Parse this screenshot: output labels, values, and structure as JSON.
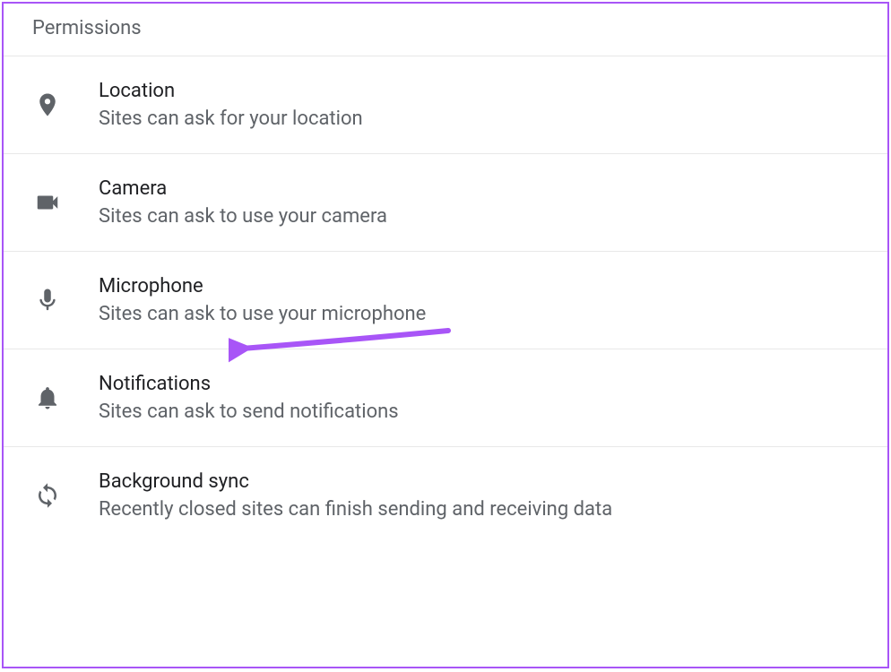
{
  "section": {
    "header": "Permissions"
  },
  "items": [
    {
      "icon": "location",
      "title": "Location",
      "subtitle": "Sites can ask for your location"
    },
    {
      "icon": "camera",
      "title": "Camera",
      "subtitle": "Sites can ask to use your camera"
    },
    {
      "icon": "microphone",
      "title": "Microphone",
      "subtitle": "Sites can ask to use your microphone"
    },
    {
      "icon": "notifications",
      "title": "Notifications",
      "subtitle": "Sites can ask to send notifications"
    },
    {
      "icon": "sync",
      "title": "Background sync",
      "subtitle": "Recently closed sites can finish sending and receiving data"
    }
  ],
  "annotation": {
    "color": "#a855f7"
  }
}
